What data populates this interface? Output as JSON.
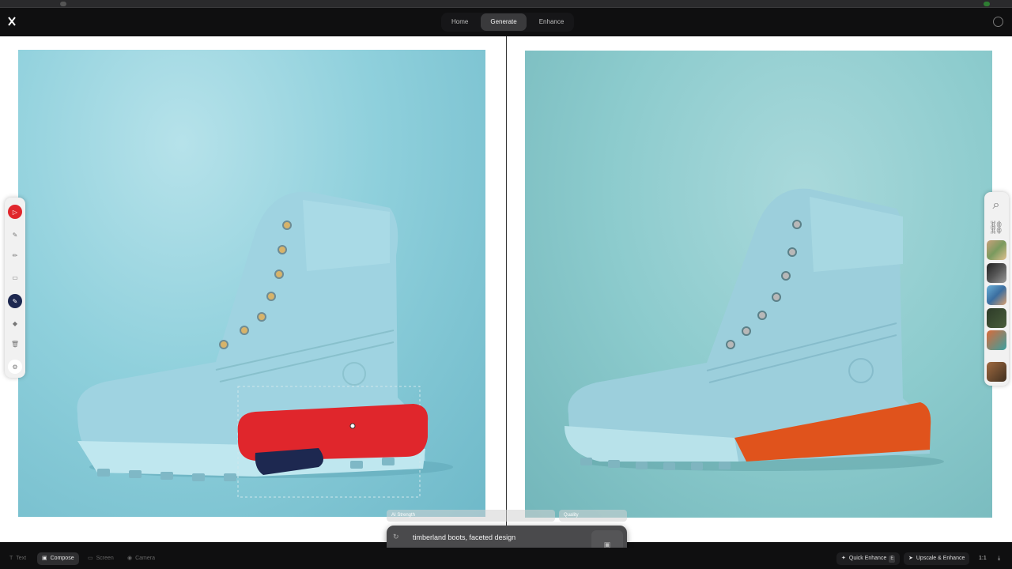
{
  "nav": {
    "tabs": [
      "Home",
      "Generate",
      "Enhance"
    ],
    "active_tab": "Generate"
  },
  "prompt": {
    "text": "timberland boots, faceted design",
    "strength_label": "AI Strength",
    "quality_label": "Quality"
  },
  "bottom": {
    "modes": [
      {
        "label": "Text",
        "icon": "text-icon"
      },
      {
        "label": "Compose",
        "icon": "compose-icon",
        "active": true
      },
      {
        "label": "Screen",
        "icon": "screen-icon"
      },
      {
        "label": "Camera",
        "icon": "camera-icon"
      }
    ],
    "quick_enhance": "Quick Enhance",
    "quick_enhance_key": "E",
    "upscale": "Upscale & Enhance",
    "ratio": "1:1"
  },
  "colors": {
    "accent_red": "#e0262c",
    "accent_navy": "#1d2850",
    "boot_blue": "#9fd3e1",
    "sole_orange": "#e0531c"
  },
  "left_tools": [
    "cursor-icon",
    "brush-icon",
    "pencil-icon",
    "fill-icon",
    "color-swatch-icon",
    "eraser-icon",
    "trash-icon",
    "settings-icon"
  ],
  "right_tools": [
    "search-icon",
    "link-icon"
  ]
}
